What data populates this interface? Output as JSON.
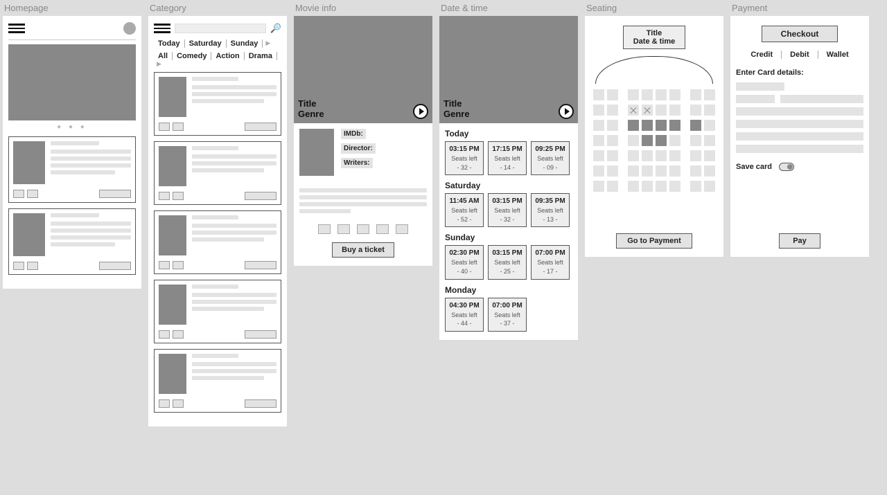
{
  "columns": {
    "homepage": "Homepage",
    "category": "Category",
    "movieinfo": "Movie info",
    "datetime": "Date & time",
    "seating": "Seating",
    "payment": "Payment"
  },
  "category": {
    "day_tabs": [
      "Today",
      "Saturday",
      "Sunday"
    ],
    "genre_tabs": [
      "All",
      "Comedy",
      "Action",
      "Drama"
    ]
  },
  "movieinfo": {
    "title": "Title",
    "genre": "Genre",
    "imdb": "IMDb:",
    "director": "Director:",
    "writers": "Writers:",
    "buy": "Buy a ticket"
  },
  "datetime": {
    "title": "Title",
    "genre": "Genre",
    "days": [
      {
        "label": "Today",
        "slots": [
          {
            "time": "03:15 PM",
            "left": "32"
          },
          {
            "time": "17:15 PM",
            "left": "14"
          },
          {
            "time": "09:25 PM",
            "left": "09"
          }
        ]
      },
      {
        "label": "Saturday",
        "slots": [
          {
            "time": "11:45 AM",
            "left": "52"
          },
          {
            "time": "03:15 PM",
            "left": "32"
          },
          {
            "time": "09:35 PM",
            "left": "13"
          }
        ]
      },
      {
        "label": "Sunday",
        "slots": [
          {
            "time": "02:30 PM",
            "left": "40"
          },
          {
            "time": "03:15 PM",
            "left": "25"
          },
          {
            "time": "07:00 PM",
            "left": "17"
          }
        ]
      },
      {
        "label": "Monday",
        "slots": [
          {
            "time": "04:30 PM",
            "left": "44"
          },
          {
            "time": "07:00 PM",
            "left": "37"
          }
        ]
      }
    ],
    "seats_left_label": "Seats left"
  },
  "seating": {
    "title": "Title",
    "subtitle": "Date & time",
    "go": "Go to Payment",
    "rows": [
      [
        [
          "o",
          "o"
        ],
        [
          "o",
          "o",
          "o",
          "o"
        ],
        [
          "o",
          "o"
        ]
      ],
      [
        [
          "o",
          "o"
        ],
        [
          "x",
          "x",
          "o",
          "o"
        ],
        [
          "o",
          "o"
        ]
      ],
      [
        [
          "o",
          "o"
        ],
        [
          "s",
          "s",
          "s",
          "s"
        ],
        [
          "s",
          "o"
        ]
      ],
      [
        [
          "o",
          "o"
        ],
        [
          "o",
          "s",
          "s",
          "o"
        ],
        [
          "o",
          "o"
        ]
      ],
      [
        [
          "o",
          "o"
        ],
        [
          "o",
          "o",
          "o",
          "o"
        ],
        [
          "o",
          "o"
        ]
      ],
      [
        [
          "o",
          "o"
        ],
        [
          "o",
          "o",
          "o",
          "o"
        ],
        [
          "o",
          "o"
        ]
      ],
      [
        [
          "o",
          "o"
        ],
        [
          "o",
          "o",
          "o",
          "o"
        ],
        [
          "o",
          "o"
        ]
      ]
    ]
  },
  "payment": {
    "checkout": "Checkout",
    "tabs": [
      "Credit",
      "Debit",
      "Wallet"
    ],
    "enter": "Enter Card details:",
    "save": "Save card",
    "pay": "Pay"
  }
}
